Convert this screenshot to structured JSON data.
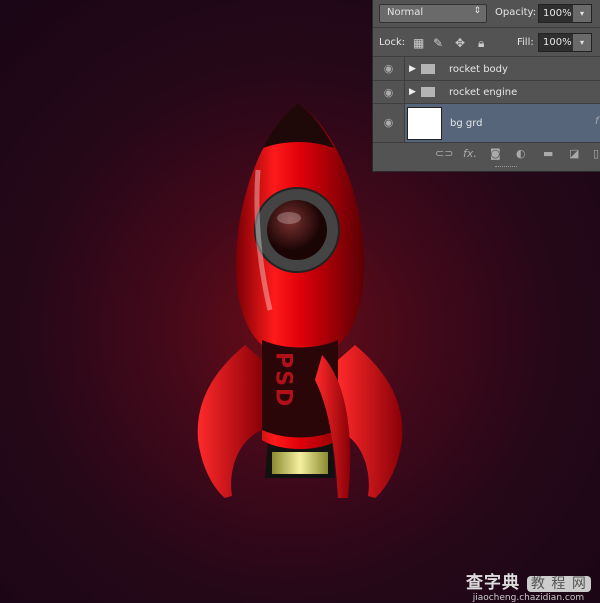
{
  "layers_panel": {
    "blend_mode": "Normal",
    "opacity_label": "Opacity:",
    "opacity": "100%",
    "lock_label": "Lock:",
    "fill_label": "Fill:",
    "fill": "100%",
    "layers": [
      {
        "name": "rocket body",
        "type": "group",
        "visible": true
      },
      {
        "name": "rocket engine",
        "type": "group",
        "visible": true
      },
      {
        "name": "bg grd",
        "type": "layer",
        "visible": true,
        "selected": true,
        "fx_glyph": "f"
      }
    ],
    "toolbar_icons": [
      "link-icon",
      "fx-icon",
      "mask-icon",
      "adjustment-icon",
      "folder-icon",
      "new-layer-icon",
      "trash-icon"
    ]
  },
  "artwork": {
    "rocket_text": "PSD",
    "colors": {
      "body": "#e0000a",
      "dark": "#1a0506",
      "bg_center": "#6a0d16",
      "bg_edge": "#1a0616"
    }
  },
  "watermark": {
    "chinese": "查字典",
    "badge": "教 程 网",
    "url": "jiaocheng.chazidian.com"
  }
}
